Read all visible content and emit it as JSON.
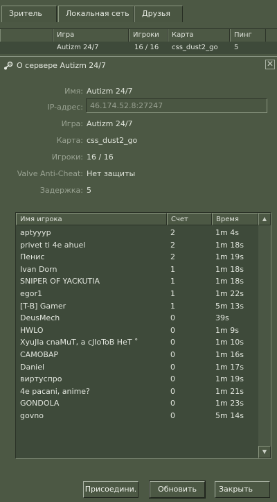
{
  "tabs": [
    "Зритель",
    "Локальная сеть",
    "Друзья"
  ],
  "server_list": {
    "columns": [
      "Игра",
      "Игроки",
      "Карта",
      "Пинг"
    ],
    "row": {
      "game": "Autizm 24/7",
      "players": "16 / 16",
      "map": "css_dust2_go",
      "ping": "5"
    }
  },
  "dialog": {
    "title": "О сервере Autizm 24/7",
    "close_icon": "close-icon",
    "info": {
      "name_label": "Имя:",
      "name_value": "Autizm 24/7",
      "ip_label": "IP-адрес:",
      "ip_value": "46.174.52.8:27247",
      "game_label": "Игра:",
      "game_value": "Autizm 24/7",
      "map_label": "Карта:",
      "map_value": "css_dust2_go",
      "players_label": "Игроки:",
      "players_value": "16 / 16",
      "vac_label": "Valve Anti-Cheat:",
      "vac_value": "Нет защиты",
      "latency_label": "Задержка:",
      "latency_value": "5"
    },
    "player_list": {
      "columns": [
        "Имя игрока",
        "Счет",
        "Время"
      ],
      "players": [
        {
          "name": "aptyyyp",
          "score": "2",
          "time": "1m 4s"
        },
        {
          "name": "privet ti 4e ahuel",
          "score": "2",
          "time": "1m 18s"
        },
        {
          "name": "Пенис",
          "score": "2",
          "time": "1m 19s"
        },
        {
          "name": "Ivan Dorn",
          "score": "1",
          "time": "1m 18s"
        },
        {
          "name": "SNIPER OF YACKUTIA",
          "score": "1",
          "time": "1m 18s"
        },
        {
          "name": "egor1",
          "score": "1",
          "time": "1m 22s"
        },
        {
          "name": "[T-B] Gamer",
          "score": "1",
          "time": "5m 13s"
        },
        {
          "name": "DeusMech",
          "score": "0",
          "time": "39s"
        },
        {
          "name": "HWLO",
          "score": "0",
          "time": "1m 9s"
        },
        {
          "name": "XyuJIa cnaMuT, a cJIoToB HeT ˚",
          "score": "0",
          "time": "1m 10s"
        },
        {
          "name": "CAMOBAP",
          "score": "0",
          "time": "1m 16s"
        },
        {
          "name": "Daniel",
          "score": "0",
          "time": "1m 17s"
        },
        {
          "name": "виртуспро",
          "score": "0",
          "time": "1m 19s"
        },
        {
          "name": "4e pacani, anime?",
          "score": "0",
          "time": "1m 21s"
        },
        {
          "name": "GONDOLA",
          "score": "0",
          "time": "1m 23s"
        },
        {
          "name": "govno",
          "score": "0",
          "time": "5m 14s"
        }
      ]
    },
    "buttons": {
      "join": "Присоедини.",
      "refresh": "Обновить",
      "close": "Закрыть"
    }
  },
  "colors": {
    "background": "#4c5844",
    "list_bg": "#3e4a3a",
    "text": "#dfe4da",
    "label": "#9aa393"
  }
}
